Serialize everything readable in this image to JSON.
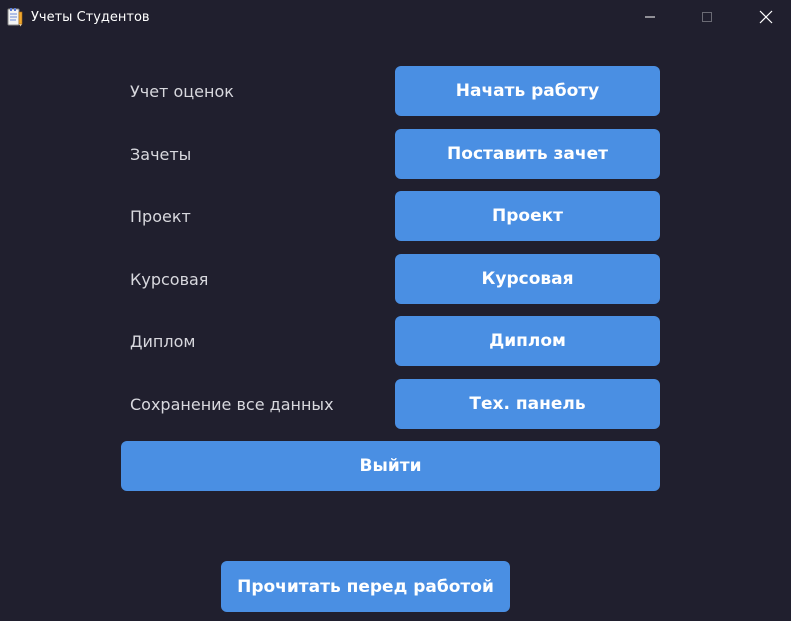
{
  "window": {
    "title": "Учеты Студентов",
    "icon": "notepad-icon"
  },
  "rows": [
    {
      "label": "Учет оценок",
      "button": "Начать работу"
    },
    {
      "label": "Зачеты",
      "button": "Поставить зачет"
    },
    {
      "label": "Проект",
      "button": "Проект"
    },
    {
      "label": "Курсовая",
      "button": "Курсовая"
    },
    {
      "label": "Диплом",
      "button": "Диплом"
    },
    {
      "label": "Сохранение все данных",
      "button": "Тех. панель"
    }
  ],
  "exit_button": "Выйти",
  "read_button": "Прочитать перед работой",
  "colors": {
    "background": "#201f2e",
    "button": "#4a8fe3",
    "label_text": "#d8d8de",
    "button_text": "#ffffff"
  }
}
